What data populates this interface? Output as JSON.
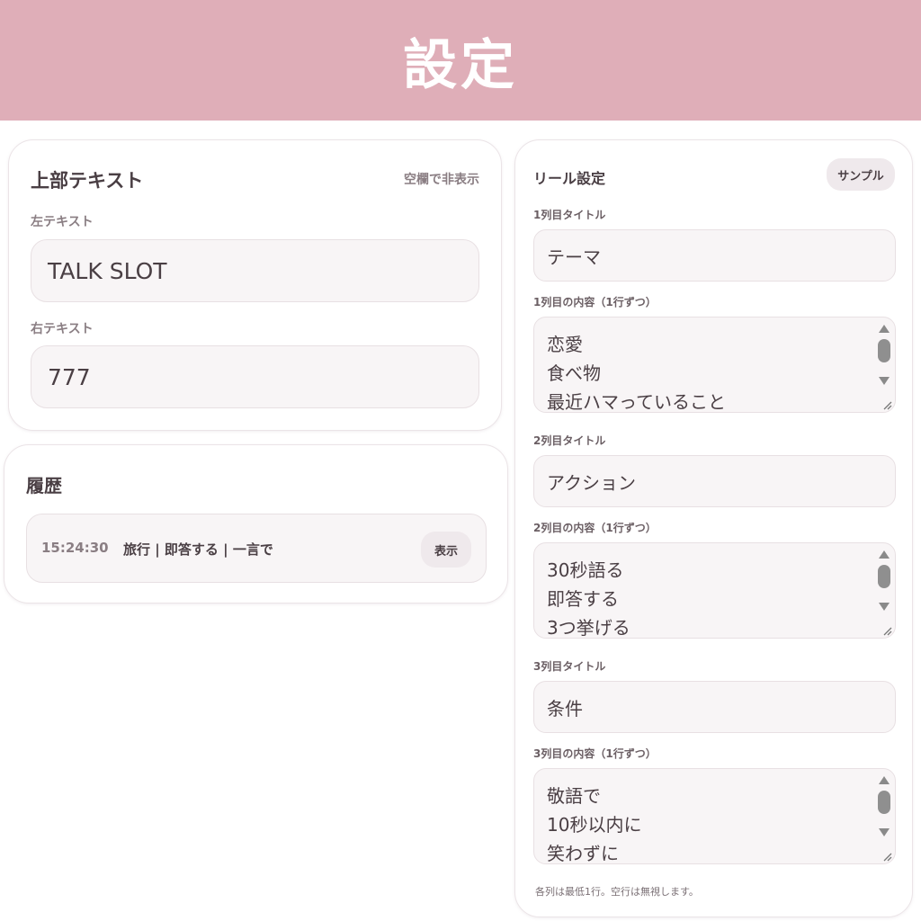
{
  "header": {
    "title": "設定"
  },
  "top_text": {
    "title": "上部テキスト",
    "hint": "空欄で非表示",
    "left_label": "左テキスト",
    "left_value": "TALK SLOT",
    "right_label": "右テキスト",
    "right_value": "777"
  },
  "history": {
    "title": "履歴",
    "items": [
      {
        "time": "15:24:30",
        "text": "旅行 | 即答する | 一言で",
        "action_label": "表示"
      }
    ]
  },
  "reel": {
    "title": "リール設定",
    "sample_label": "サンプル",
    "columns": [
      {
        "title_label": "1列目タイトル",
        "title_value": "テーマ",
        "content_label": "1列目の内容（1行ずつ）",
        "lines": [
          "恋愛",
          "食べ物",
          "最近ハマっていること"
        ]
      },
      {
        "title_label": "2列目タイトル",
        "title_value": "アクション",
        "content_label": "2列目の内容（1行ずつ）",
        "lines": [
          "30秒語る",
          "即答する",
          "3つ挙げる"
        ]
      },
      {
        "title_label": "3列目タイトル",
        "title_value": "条件",
        "content_label": "3列目の内容（1行ずつ）",
        "lines": [
          "敬語で",
          "10秒以内に",
          "笑わずに"
        ]
      }
    ],
    "footnote": "各列は最低1行。空行は無視します。"
  },
  "colors": {
    "header_bg": "#dfaeb8",
    "field_bg": "#f8f5f6",
    "text": "#4a3f44",
    "muted": "#8a7e83"
  }
}
